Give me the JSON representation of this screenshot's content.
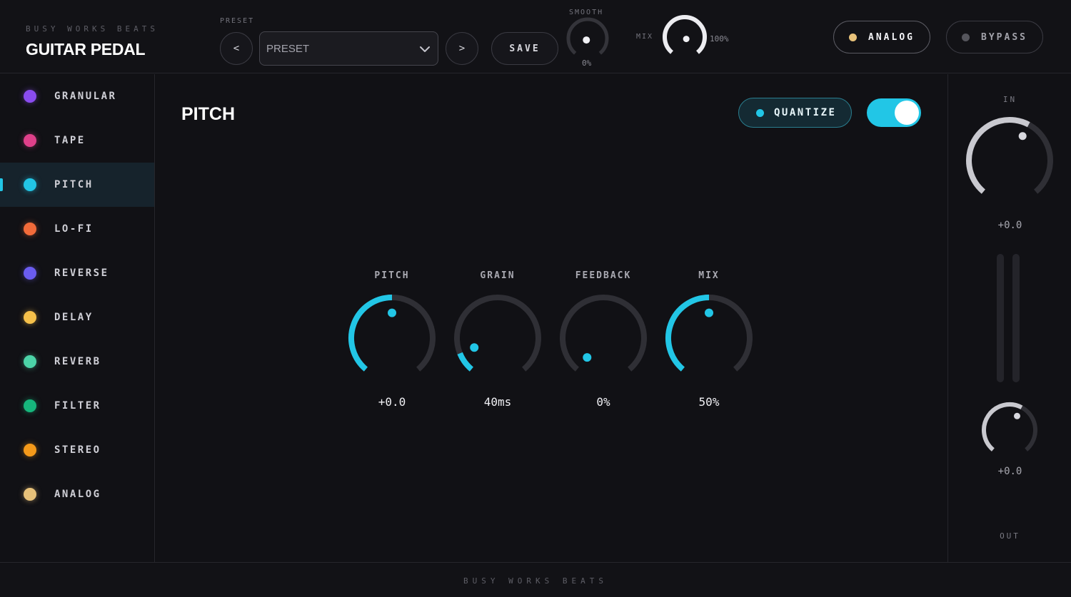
{
  "header": {
    "brand_sub": "BUSY WORKS BEATS",
    "brand_title": "GUITAR PEDAL",
    "preset_label": "PRESET",
    "prev_label": "<",
    "next_label": ">",
    "preset_value": "PRESET",
    "save_label": "SAVE",
    "smooth": {
      "label": "SMOOTH",
      "value": "0%",
      "level": 0.0
    },
    "mix": {
      "label": "MIX",
      "value": "100%",
      "level": 1.0
    },
    "analog": {
      "label": "ANALOG",
      "dot_color": "#e8c27a"
    },
    "bypass": {
      "label": "BYPASS",
      "dot_color": "#55555c"
    }
  },
  "sidebar": {
    "active_color": "#22c6e6",
    "items": [
      {
        "label": "GRANULAR",
        "color": "#8a4cf0"
      },
      {
        "label": "TAPE",
        "color": "#e0408a"
      },
      {
        "label": "PITCH",
        "color": "#22c6e6",
        "active": true
      },
      {
        "label": "LO-FI",
        "color": "#f26b3a"
      },
      {
        "label": "REVERSE",
        "color": "#6a5cf0"
      },
      {
        "label": "DELAY",
        "color": "#f5c04a"
      },
      {
        "label": "REVERB",
        "color": "#4cd4a8"
      },
      {
        "label": "FILTER",
        "color": "#16b67c"
      },
      {
        "label": "STEREO",
        "color": "#f59a1a"
      },
      {
        "label": "ANALOG",
        "color": "#e8c27a"
      }
    ]
  },
  "main": {
    "title": "PITCH",
    "quantize_label": "QUANTIZE",
    "toggle_on": true,
    "accent": "#22c6e6",
    "knobs": [
      {
        "label": "PITCH",
        "value": "+0.0",
        "level": 0.5
      },
      {
        "label": "GRAIN",
        "value": "40ms",
        "level": 0.1
      },
      {
        "label": "FEEDBACK",
        "value": "0%",
        "level": 0.0
      },
      {
        "label": "MIX",
        "value": "50%",
        "level": 0.5
      }
    ]
  },
  "right_panel": {
    "in_label": "IN",
    "in_value": "+0.0",
    "in_level": 0.6,
    "out_value": "+0.0",
    "out_level": 0.6,
    "out_label": "OUT"
  },
  "footer": {
    "text": "BUSY WORKS BEATS"
  }
}
